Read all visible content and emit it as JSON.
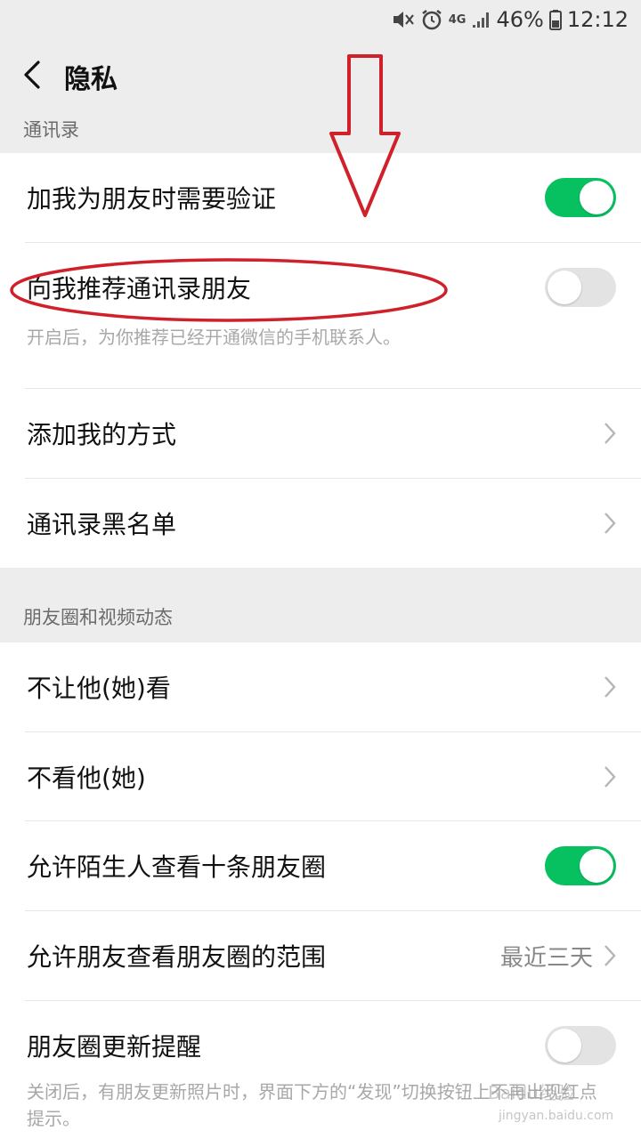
{
  "status_bar": {
    "battery": "46%",
    "time": "12:12",
    "network": "4G"
  },
  "header": {
    "title": "隐私"
  },
  "sections": {
    "contacts": {
      "label": "通讯录",
      "items": [
        {
          "label": "加我为朋友时需要验证",
          "toggle": "on"
        },
        {
          "label": "向我推荐通讯录朋友",
          "toggle": "off",
          "description": "开启后，为你推荐已经开通微信的手机联系人。"
        },
        {
          "label": "添加我的方式"
        },
        {
          "label": "通讯录黑名单"
        }
      ]
    },
    "moments": {
      "label": "朋友圈和视频动态",
      "items": [
        {
          "label": "不让他(她)看"
        },
        {
          "label": "不看他(她)"
        },
        {
          "label": "允许陌生人查看十条朋友圈",
          "toggle": "on"
        },
        {
          "label": "允许朋友查看朋友圈的范围",
          "value": "最近三天"
        },
        {
          "label": "朋友圈更新提醒",
          "toggle": "off",
          "description": "关闭后，有朋友更新照片时，界面下方的“发现”切换按钮上不再出现红点提示。"
        }
      ]
    }
  },
  "watermark": {
    "text": "Baidu经验",
    "sub": "jingyan.baidu.com"
  },
  "colors": {
    "toggle_on": "#07c160",
    "toggle_off": "#e3e3e3",
    "annotation": "#d0202a",
    "background": "#ededed"
  }
}
